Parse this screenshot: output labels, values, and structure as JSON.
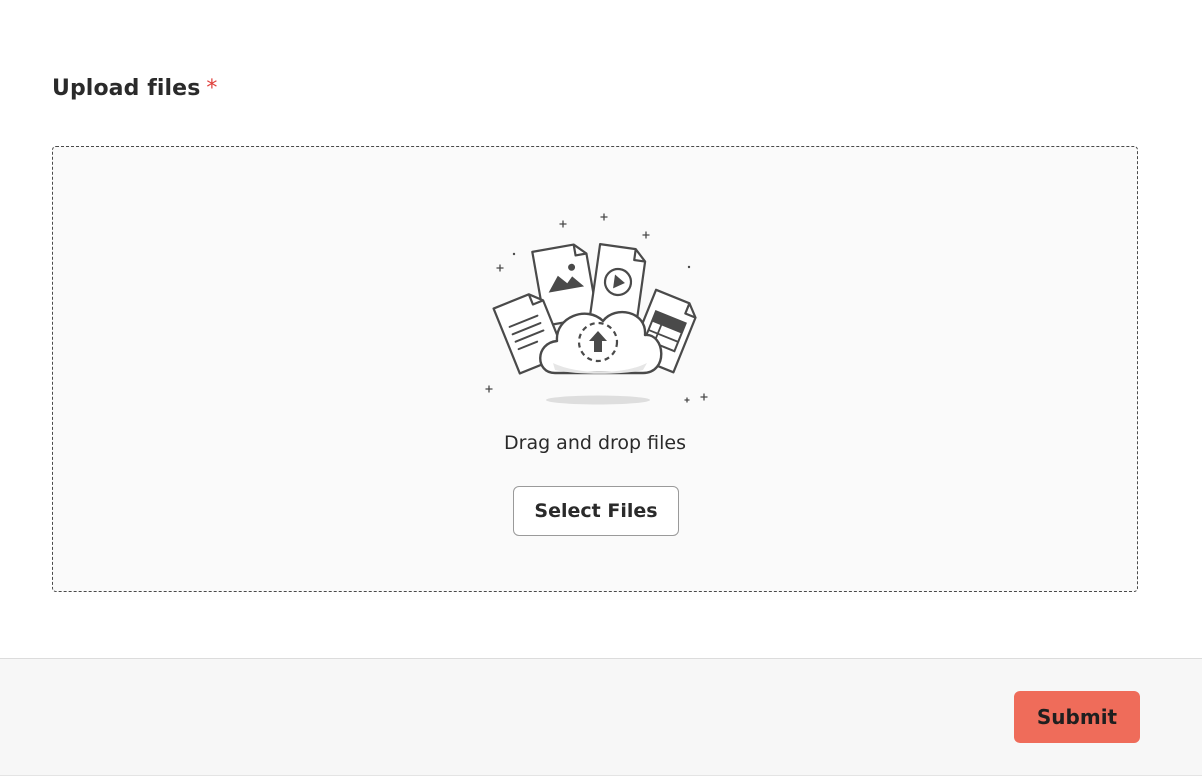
{
  "form": {
    "field_label": "Upload files",
    "required_mark": "*"
  },
  "dropzone": {
    "illustration_icon": "cloud-upload-files-icon",
    "drop_text": "Drag and drop files",
    "select_button_label": "Select Files"
  },
  "footer": {
    "submit_label": "Submit"
  },
  "colors": {
    "required": "#e0413c",
    "submit_bg": "#ef6c5a",
    "dropzone_bg": "#fafafa",
    "footer_bg": "#f7f7f7"
  }
}
